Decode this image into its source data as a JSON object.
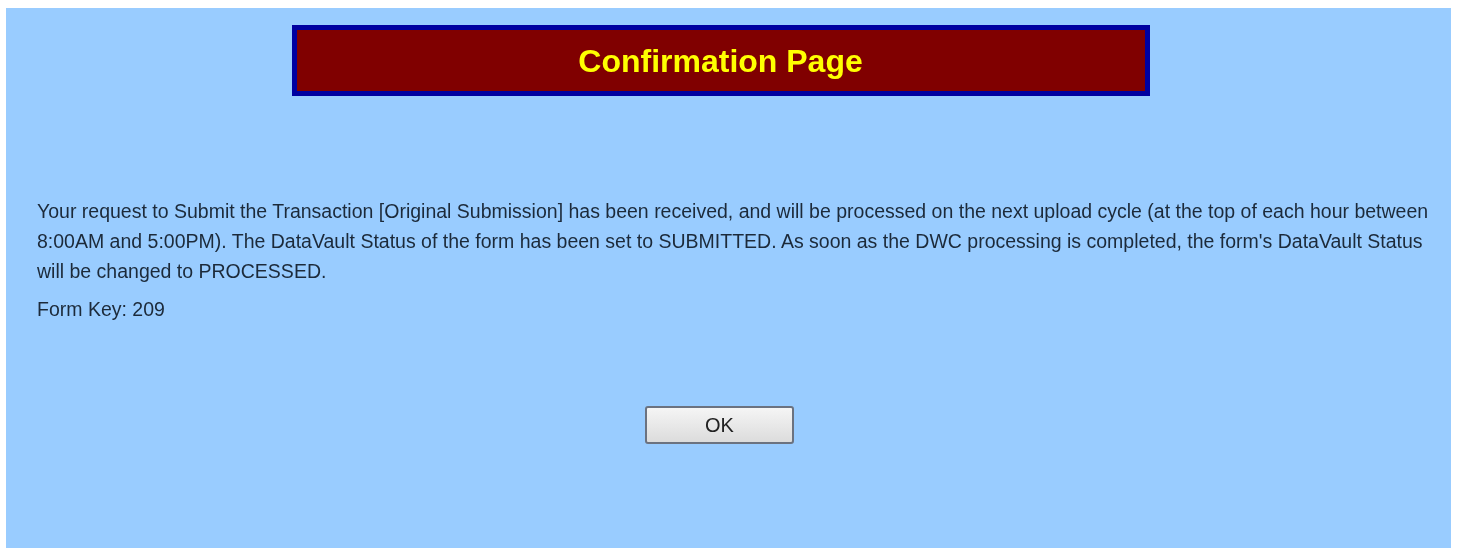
{
  "title": "Confirmation Page",
  "message": "Your request to Submit the Transaction [Original Submission] has been received, and will be processed on the next upload cycle (at the top of each hour between 8:00AM and 5:00PM). The DataVault Status of the form has been set to SUBMITTED. As soon as the DWC processing is completed, the form's DataVault Status will be changed to PROCESSED.",
  "form_key": "Form Key: 209",
  "buttons": [
    "OK"
  ]
}
